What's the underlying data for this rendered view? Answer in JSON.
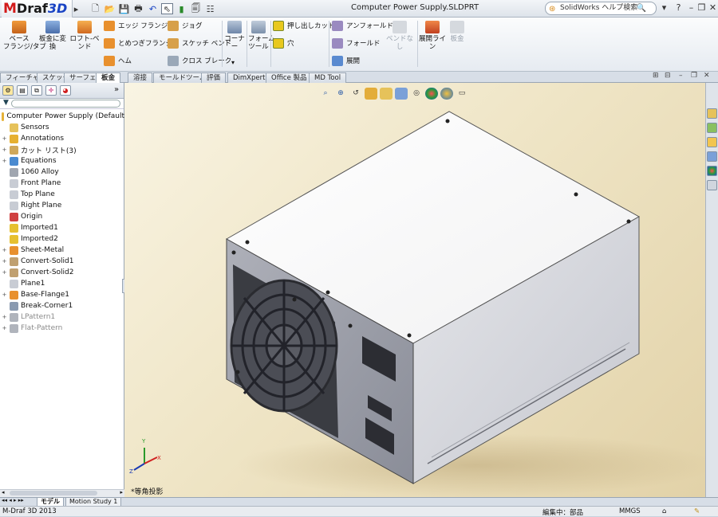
{
  "app": {
    "logo": "MDraf3D",
    "logo_parts": [
      "M",
      "Draf",
      "3D"
    ],
    "document_title": "Computer Power Supply.SLDPRT",
    "search_placeholder": "SolidWorks ヘルプ検索"
  },
  "ribbon": {
    "big_buttons": [
      {
        "label": "ベース\nフランジ/タブ",
        "icon": "base-flange-icon"
      },
      {
        "label": "板金に変\n換",
        "icon": "convert-sheetmetal-icon"
      },
      {
        "label": "ロフト-ベンド",
        "icon": "loft-bend-icon"
      }
    ],
    "small_col1": [
      "エッジ フランジ",
      "とめつぎフランジ",
      "ヘム"
    ],
    "small_col2": [
      "ジョグ",
      "スケッチ ベンド",
      "クロス ブレーク"
    ],
    "corner": "コーナー",
    "forming_tool": "フォーム\nツール",
    "cut_col": [
      "押し出しカット",
      "穴"
    ],
    "fold_col": [
      "アンフォールド",
      "フォールド",
      "展開"
    ],
    "no_bend": "ベンドなし",
    "flatten_line": "展開ライン",
    "sheet_metal": "板金"
  },
  "tabs": [
    "フィーチャー",
    "スケッチ",
    "サーフェス",
    "板金",
    "溶接",
    "モールドツール",
    "評価",
    "DimXpert",
    "Office 製品",
    "MD Tool"
  ],
  "active_tab": "板金",
  "tree": {
    "root": "Computer Power Supply  (Default",
    "items": [
      {
        "label": "Sensors",
        "exp": "",
        "dim": false
      },
      {
        "label": "Annotations",
        "exp": "+",
        "dim": false
      },
      {
        "label": "カット リスト(3)",
        "exp": "+",
        "dim": false
      },
      {
        "label": "Equations",
        "exp": "+",
        "dim": false
      },
      {
        "label": "1060 Alloy",
        "exp": "",
        "dim": false
      },
      {
        "label": "Front Plane",
        "exp": "",
        "dim": false
      },
      {
        "label": "Top Plane",
        "exp": "",
        "dim": false
      },
      {
        "label": "Right Plane",
        "exp": "",
        "dim": false
      },
      {
        "label": "Origin",
        "exp": "",
        "dim": false
      },
      {
        "label": "Imported1",
        "exp": "",
        "dim": false
      },
      {
        "label": "Imported2",
        "exp": "",
        "dim": false
      },
      {
        "label": "Sheet-Metal",
        "exp": "+",
        "dim": false
      },
      {
        "label": "Convert-Solid1",
        "exp": "+",
        "dim": false
      },
      {
        "label": "Convert-Solid2",
        "exp": "+",
        "dim": false
      },
      {
        "label": "Plane1",
        "exp": "",
        "dim": false
      },
      {
        "label": "Base-Flange1",
        "exp": "+",
        "dim": false
      },
      {
        "label": "Break-Corner1",
        "exp": "",
        "dim": false
      },
      {
        "label": "LPattern1",
        "exp": "+",
        "dim": true
      },
      {
        "label": "Flat-Pattern",
        "exp": "+",
        "dim": true
      }
    ]
  },
  "viewport": {
    "view_label": "*等角投影",
    "triad": {
      "x": "X",
      "y": "Y",
      "z": "Z"
    }
  },
  "bottom_tabs": [
    "モデル",
    "Motion Study 1"
  ],
  "status": {
    "app_version": "M-Draf 3D 2013",
    "mode": "編集中：部品",
    "units": "MMGS"
  },
  "colors": {
    "accent": "#d21a1a",
    "title_bar": "#e8ecf1",
    "viewport_bg": "#efe5c6"
  }
}
